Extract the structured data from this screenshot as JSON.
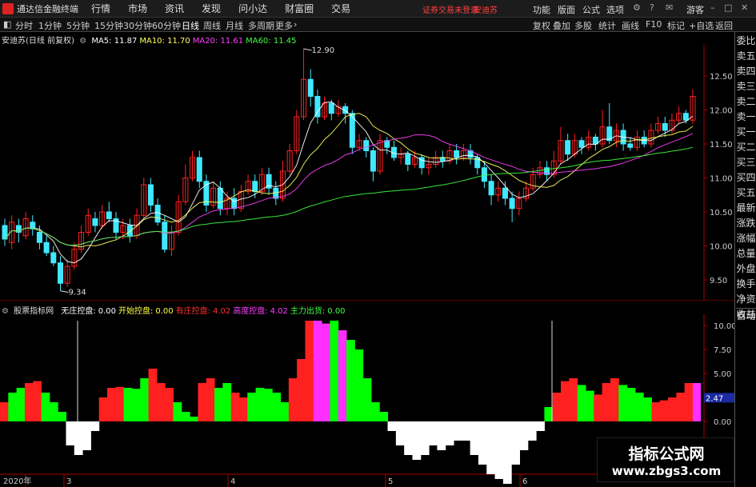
{
  "app": {
    "title": "通达信金融终端",
    "menu": [
      "行情",
      "市场",
      "资讯",
      "发现",
      "问小达",
      "财富圈",
      "交易"
    ],
    "security_alert": "证券交易未登录",
    "security_name": "安迪苏",
    "right_menu": [
      "功能",
      "版面",
      "公式",
      "选项",
      "游客"
    ]
  },
  "toolbar": {
    "periods": [
      "分时",
      "1分钟",
      "5分钟",
      "15分钟",
      "30分钟",
      "60分钟",
      "日线",
      "周线",
      "月线",
      "多周期",
      "更多"
    ],
    "active_period": "日线",
    "right_tools": [
      "复权",
      "叠加",
      "多股",
      "统计",
      "画线",
      "F10",
      "标记",
      "+自选",
      "返回"
    ]
  },
  "main_chart": {
    "title": "安迪苏(日线 前复权)",
    "ma": [
      {
        "label": "MA5:",
        "value": "11.87",
        "color": "#ffffff"
      },
      {
        "label": "MA10:",
        "value": "11.70",
        "color": "#ffff60"
      },
      {
        "label": "MA20:",
        "value": "11.61",
        "color": "#ff40ff"
      },
      {
        "label": "MA60:",
        "value": "11.45",
        "color": "#40ff40"
      }
    ],
    "y_ticks": [
      "12.50",
      "12.00",
      "11.50",
      "11.00",
      "10.50",
      "10.00",
      "9.50"
    ],
    "high_label": "12.90",
    "low_label": "9.34"
  },
  "indicator": {
    "name": "股票指标网",
    "items": [
      {
        "label": "无庄控盘:",
        "value": "0.00",
        "color": "#ffffff"
      },
      {
        "label": "开始控盘:",
        "value": "0.00",
        "color": "#ffff40"
      },
      {
        "label": "有庄控盘:",
        "value": "4.02",
        "color": "#ff3030"
      },
      {
        "label": "高度控盘:",
        "value": "4.02",
        "color": "#ff40ff"
      },
      {
        "label": "主力出货:",
        "value": "0.00",
        "color": "#40ff40"
      }
    ],
    "y_ticks": [
      "10.00",
      "7.50",
      "5.00",
      "2.50",
      "0.00"
    ],
    "current_value": "2.47"
  },
  "x_axis": {
    "labels": [
      "2020年",
      "3",
      "4",
      "5",
      "6"
    ]
  },
  "right_panel": {
    "items": [
      "委比",
      "卖五",
      "卖四",
      "卖三",
      "卖二",
      "卖一",
      "买一",
      "买二",
      "买三",
      "买四",
      "买五",
      "最新",
      "涨跌",
      "涨幅",
      "总量",
      "外盘",
      "换手",
      "净资",
      "收益"
    ],
    "bottom": "自动"
  },
  "watermark": {
    "line1": "指标公式网",
    "line2": "www.zbgs3.com"
  },
  "colors": {
    "up": "#ff2020",
    "down": "#40e8ff",
    "ind_green": "#00ff00",
    "ind_magenta": "#ff30ff",
    "ind_white": "#ffffff"
  }
}
